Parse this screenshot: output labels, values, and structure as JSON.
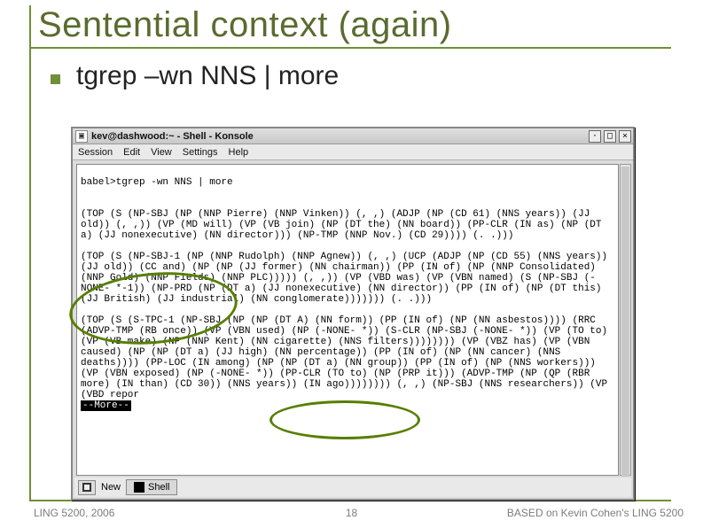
{
  "slide": {
    "title": "Sentential context (again)",
    "bullet": "tgrep –wn NNS | more"
  },
  "window": {
    "title": "kev@dashwood:~ - Shell - Konsole",
    "sysicon": "▣",
    "buttons": {
      "min": "·",
      "max": "□",
      "close": "×"
    },
    "menu": [
      "Session",
      "Edit",
      "View",
      "Settings",
      "Help"
    ],
    "tabbar": {
      "new_label": "New",
      "tab_label": "Shell"
    }
  },
  "terminal": {
    "prompt": "babel>tgrep -wn NNS | more",
    "blocks": [
      "(TOP (S (NP-SBJ (NP (NNP Pierre) (NNP Vinken)) (, ,) (ADJP (NP (CD 61) (NNS years)) (JJ old)) (, ,)) (VP (MD will) (VP (VB join) (NP (DT the) (NN board)) (PP-CLR (IN as) (NP (DT a) (JJ nonexecutive) (NN director))) (NP-TMP (NNP Nov.) (CD 29)))) (. .)))",
      "(TOP (S (NP-SBJ-1 (NP (NNP Rudolph) (NNP Agnew)) (, ,) (UCP (ADJP (NP (CD 55) (NNS years)) (JJ old)) (CC and) (NP (NP (JJ former) (NN chairman)) (PP (IN of) (NP (NNP Consolidated) (NNP Gold) (NNP Fields) (NNP PLC))))) (, ,)) (VP (VBD was) (VP (VBN named) (S (NP-SBJ (-NONE- *-1)) (NP-PRD (NP (DT a) (JJ nonexecutive) (NN director)) (PP (IN of) (NP (DT this) (JJ British) (JJ industrial) (NN conglomerate))))))) (. .)))",
      "(TOP (S (S-TPC-1 (NP-SBJ (NP (NP (DT A) (NN form)) (PP (IN of) (NP (NN asbestos)))) (RRC (ADVP-TMP (RB once)) (VP (VBN used) (NP (-NONE- *)) (S-CLR (NP-SBJ (-NONE- *)) (VP (TO to) (VP (VB make) (NP (NNP Kent) (NN cigarette) (NNS filters)))))))) (VP (VBZ has) (VP (VBN caused) (NP (NP (DT a) (JJ high) (NN percentage)) (PP (IN of) (NP (NN cancer) (NNS deaths)))) (PP-LOC (IN among) (NP (NP (DT a) (NN group)) (PP (IN of) (NP (NNS workers))) (VP (VBN exposed) (NP (-NONE- *)) (PP-CLR (TO to) (NP (PRP it))) (ADVP-TMP (NP (QP (RBR more) (IN than) (CD 30)) (NNS years)) (IN ago)))))))) (, ,) (NP-SBJ (NNS researchers)) (VP (VBD repor"
    ],
    "more": "--More--"
  },
  "footer": {
    "left": "LING 5200, 2006",
    "mid": "18",
    "right": "BASED on Kevin Cohen's LING 5200"
  }
}
